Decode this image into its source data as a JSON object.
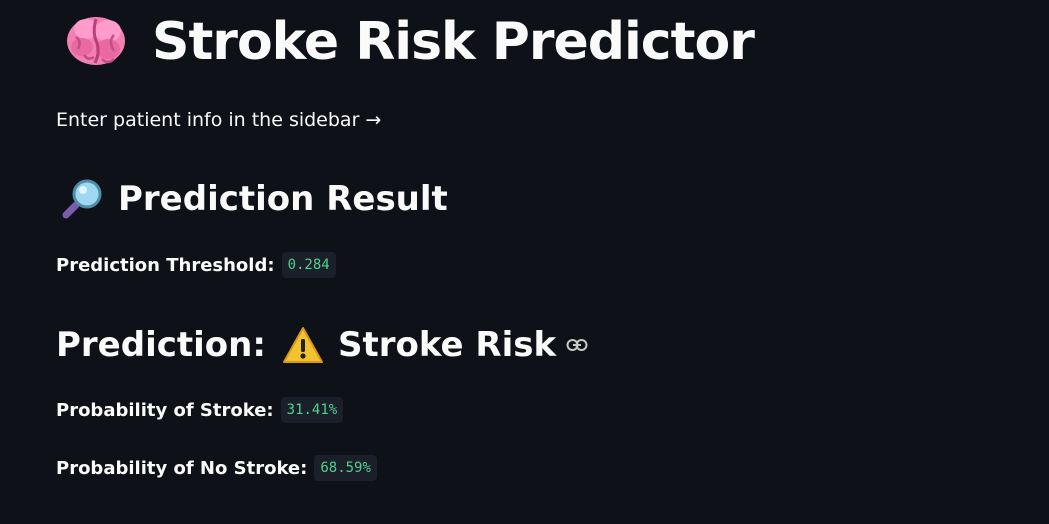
{
  "header": {
    "title": "Stroke Risk Predictor",
    "title_icon": "brain-icon"
  },
  "caption": "Enter patient info in the sidebar →",
  "prediction_section": {
    "heading": "Prediction Result",
    "heading_icon": "magnifying-glass-icon",
    "threshold_label": "Prediction Threshold:",
    "threshold_value": "0.284"
  },
  "prediction": {
    "label": "Prediction:",
    "result": "Stroke Risk",
    "result_icon": "warning-icon",
    "anchor_icon": "link-icon"
  },
  "probabilities": {
    "stroke_label": "Probability of Stroke:",
    "stroke_value": "31.41%",
    "no_stroke_label": "Probability of No Stroke:",
    "no_stroke_value": "68.59%"
  },
  "colors": {
    "background": "#0e1117",
    "text": "#fafafa",
    "code_bg": "#1b1f2a",
    "code_text": "#4fd18b",
    "warning": "#f2c230"
  }
}
